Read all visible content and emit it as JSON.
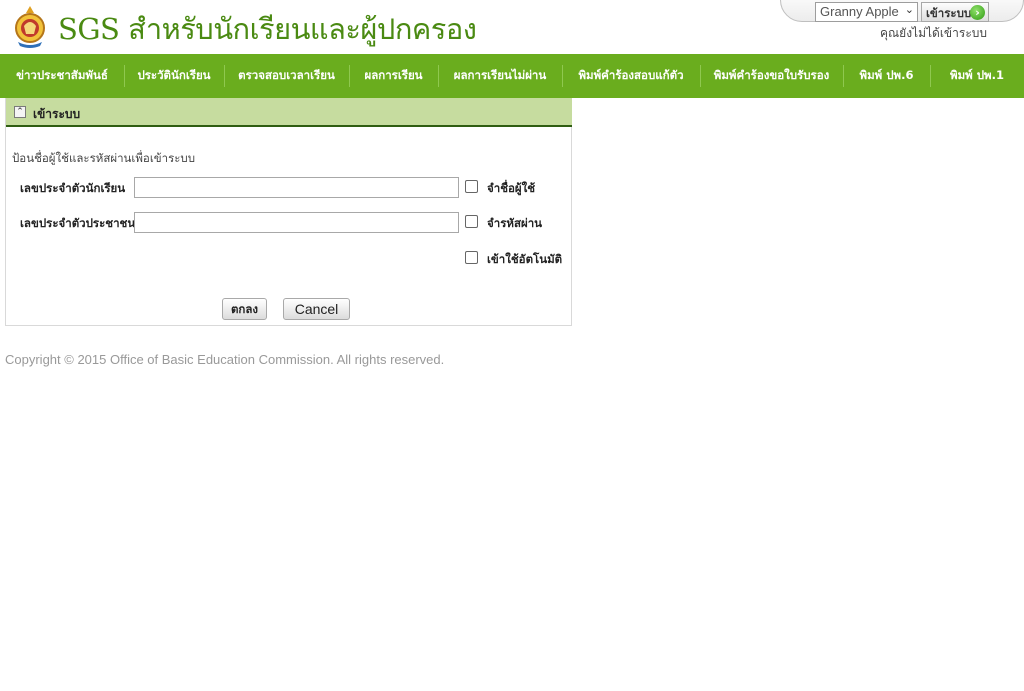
{
  "header": {
    "title": "SGS สำหรับนักเรียนและผู้ปกครอง",
    "logo_icon": "school-emblem-icon"
  },
  "account": {
    "selected_user": "Granny Apple",
    "login_button": "เข้าระบบ",
    "status": "คุณยังไม่ได้เข้าระบบ"
  },
  "nav": {
    "items": [
      "ข่าวประชาสัมพันธ์",
      "ประวัตินักเรียน",
      "ตรวจสอบเวลาเรียน",
      "ผลการเรียน",
      "ผลการเรียนไม่ผ่าน",
      "พิมพ์คำร้องสอบแก้ตัว",
      "พิมพ์คำร้องขอใบรับรอง",
      "พิมพ์ ปพ.6",
      "พิมพ์ ปพ.1"
    ]
  },
  "panel": {
    "title": "เข้าระบบ",
    "instruction": "ป้อนชื่อผู้ใช้และรหัสผ่านเพื่อเข้าระบบ",
    "student_id_label": "เลขประจำตัวนักเรียน",
    "student_id_value": "",
    "citizen_id_label": "เลขประจำตัวประชาชน",
    "citizen_id_value": "",
    "remember_user": "จำชื่อผู้ใช้",
    "remember_password": "จำรหัสผ่าน",
    "auto_login": "เข้าใช้อัตโนมัติ",
    "ok_button": "ตกลง",
    "cancel_button": "Cancel"
  },
  "footer": {
    "copyright": "Copyright © 2015 Office of Basic Education Commission. All rights reserved."
  },
  "colors": {
    "brand_green": "#6aad1e",
    "title_green": "#4a8a12",
    "panel_header": "#c6dc9f"
  }
}
